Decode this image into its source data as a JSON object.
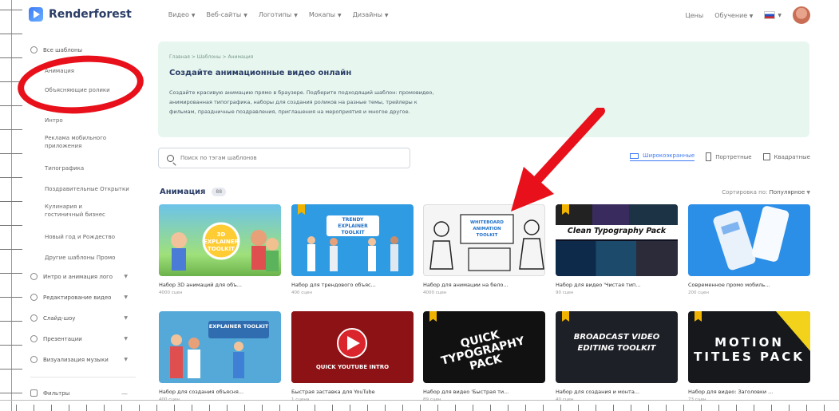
{
  "header": {
    "logo": "Renderforest",
    "nav": [
      "Видео",
      "Веб-сайты",
      "Логотипы",
      "Мокапы",
      "Дизайны"
    ],
    "right": [
      "Цены",
      "Обучение"
    ]
  },
  "sidebar": {
    "items": [
      {
        "label": "Все шаблоны",
        "group": true
      },
      {
        "label": "Анимация"
      },
      {
        "label": "Объясняющие ролики"
      },
      {
        "label": "Интро"
      },
      {
        "label": "Реклама мобильного приложения"
      },
      {
        "label": "Типографика"
      },
      {
        "label": "Поздравительные Открытки"
      },
      {
        "label": "Кулинария и гостиничный бизнес"
      },
      {
        "label": "Новый год и Рождество"
      },
      {
        "label": "Другие шаблоны Промо"
      },
      {
        "label": "Интро и анимация лого",
        "group": true
      },
      {
        "label": "Редактирование видео",
        "group": true
      },
      {
        "label": "Слайд-шоу",
        "group": true
      },
      {
        "label": "Презентации",
        "group": true
      },
      {
        "label": "Визуализация музыки",
        "group": true
      },
      {
        "label": "Фильтры",
        "group": true
      }
    ]
  },
  "hero": {
    "breadcrumbs": "Главная  >  Шаблоны  >  Анимация",
    "title": "Создайте анимационные видео онлайн",
    "description": "Создайте красивую анимацию прямо в браузере. Подберите подходящий шаблон: промовидео, анимированная типографика, наборы для создания роликов на разные темы, трейлеры к фильмам, праздничные поздравления, приглашения на мероприятия и многое другое."
  },
  "search": {
    "placeholder": "Поиск по тэгам шаблонов"
  },
  "formats": {
    "horizontal": "Широкоэкранные",
    "portrait": "Портретные",
    "square": "Квадратные"
  },
  "section": {
    "title": "Анимация",
    "count": "88",
    "sort_label": "Сортировка по:",
    "sort_value": "Популярное"
  },
  "cards": [
    {
      "title": "Набор 3D анимаций для объ...",
      "meta": "4000 сцен",
      "thumb_text": "3D EXPLAINER TOOLKIT",
      "premium": false
    },
    {
      "title": "Набор для трендового объяс...",
      "meta": "400 сцен",
      "thumb_text": "TRENDY EXPLAINER TOOLKIT",
      "premium": true
    },
    {
      "title": "Набор для анимации на бело...",
      "meta": "4000 сцен",
      "thumb_text": "WHITEBOARD ANIMATION TOOLKIT",
      "premium": false
    },
    {
      "title": "Набор для видео 'Чистая тип...",
      "meta": "90 сцен",
      "thumb_text": "Clean Typography Pack",
      "premium": true
    },
    {
      "title": "Современное промо мобиль...",
      "meta": "200 сцен",
      "thumb_text": "",
      "premium": false
    },
    {
      "title": "Набор для создания объясня...",
      "meta": "400 сцен",
      "thumb_text": "EXPLAINER TOOLKIT",
      "premium": false
    },
    {
      "title": "Быстрая заставка для YouTube",
      "meta": "1 сцена",
      "thumb_text": "QUICK YOUTUBE INTRO",
      "premium": false
    },
    {
      "title": "Набор для видео 'Быстрая ти...",
      "meta": "89 сцен",
      "thumb_text": "QUICK TYPOGRAPHY PACK",
      "premium": true
    },
    {
      "title": "Набор для создания и монта...",
      "meta": "40 сцен",
      "thumb_text": "BROADCAST VIDEO EDITING TOOLKIT",
      "premium": true
    },
    {
      "title": "Набор для видео: Заголовки ...",
      "meta": "73 сцен",
      "thumb_text": "MOTION TITLES PACK",
      "premium": true
    }
  ],
  "colors": {
    "accent": "#3d7bf7",
    "hero_bg": "#e7f6ef",
    "annotation": "#e8101a",
    "badge": "#f0b400"
  }
}
